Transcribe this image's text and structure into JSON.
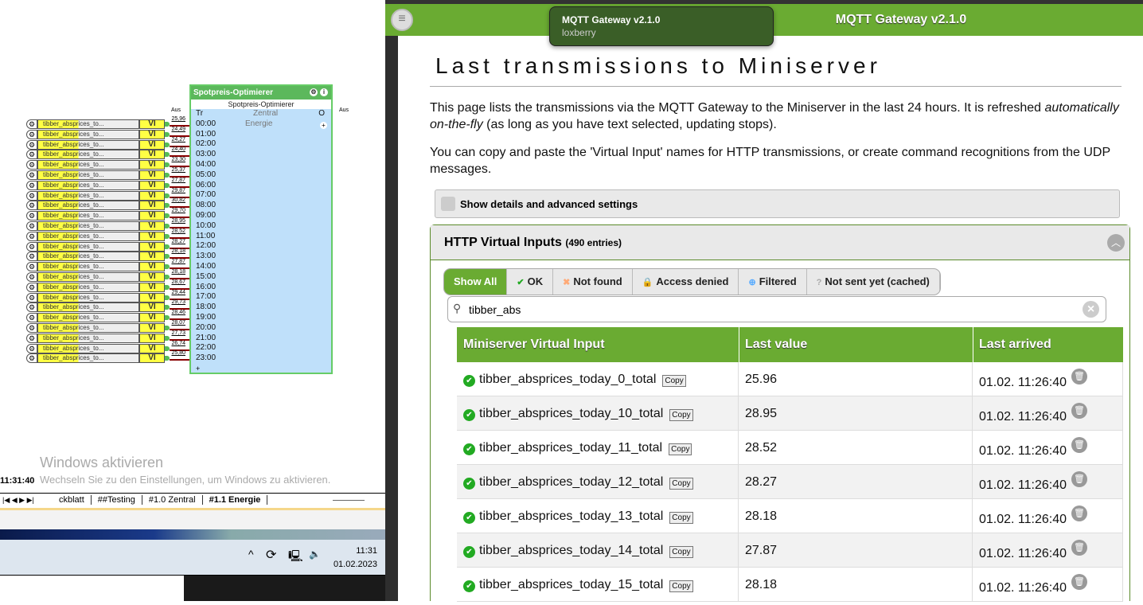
{
  "loxone": {
    "vi_name": "tibber_absprices_to...",
    "vi_label": "VI",
    "vi_values": [
      "25,96",
      "24,49",
      "24,27",
      "24,40",
      "23,30",
      "25,37",
      "27,87",
      "29,87",
      "30,82",
      "29,70",
      "28,95",
      "28,52",
      "28,27",
      "28,18",
      "27,87",
      "28,18",
      "28,67",
      "29,44",
      "29,73",
      "28,46",
      "28,07",
      "27,73",
      "26,74",
      "25,80"
    ],
    "wire_label": "---",
    "aus_in": "Aus",
    "aus_out": "Aus",
    "block_title": "Spotpreis-Optimierer",
    "block_subtitle": "Spotpreis-Optimierer",
    "input_tr": "Tr",
    "room": "Zentral",
    "category": "Energie",
    "output_o": "O",
    "hours": [
      "00:00",
      "01:00",
      "02:00",
      "03:00",
      "04:00",
      "05:00",
      "06:00",
      "07:00",
      "08:00",
      "09:00",
      "10:00",
      "11:00",
      "12:00",
      "13:00",
      "14:00",
      "15:00",
      "16:00",
      "17:00",
      "18:00",
      "19:00",
      "20:00",
      "21:00",
      "22:00",
      "23:00"
    ],
    "time": "11:31:40",
    "tabs": [
      "ckblatt",
      "##Testing",
      "#1.0 Zentral",
      "#1.1 Energie"
    ]
  },
  "windows": {
    "activate_title": "Windows aktivieren",
    "activate_text": "Wechseln Sie zu den Einstellungen, um Windows zu aktivieren.",
    "clock_time": "11:31",
    "clock_date": "01.02.2023"
  },
  "tooltip": {
    "title": "MQTT Gateway v2.1.0",
    "subtitle": "loxberry"
  },
  "header": {
    "title": "MQTT Gateway v2.1.0"
  },
  "page": {
    "title": "Last transmissions to Miniserver",
    "intro_1": "This page lists the transmissions via the MQTT Gateway to the Miniserver in the last 24 hours. It is refreshed ",
    "intro_em": "automatically on-the-fly",
    "intro_2": " (as long as you have text selected, updating stops).",
    "intro_p2": "You can copy and paste the 'Virtual Input' names for HTTP transmissions, or create command recognitions from the UDP messages.",
    "details_label": "Show details and advanced settings",
    "section_title": "HTTP Virtual Inputs",
    "section_count": "(490 entries)",
    "filters": [
      "Show All",
      "OK",
      "Not found",
      "Access denied",
      "Filtered",
      "Not sent yet (cached)"
    ],
    "search_value": "tibber_abs",
    "columns": [
      "Miniserver Virtual Input",
      "Last value",
      "Last arrived"
    ],
    "copy_label": "Copy",
    "rows": [
      {
        "name": "tibber_absprices_today_0_total",
        "value": "25.96",
        "arrived": "01.02. 11:26:40"
      },
      {
        "name": "tibber_absprices_today_10_total",
        "value": "28.95",
        "arrived": "01.02. 11:26:40"
      },
      {
        "name": "tibber_absprices_today_11_total",
        "value": "28.52",
        "arrived": "01.02. 11:26:40"
      },
      {
        "name": "tibber_absprices_today_12_total",
        "value": "28.27",
        "arrived": "01.02. 11:26:40"
      },
      {
        "name": "tibber_absprices_today_13_total",
        "value": "28.18",
        "arrived": "01.02. 11:26:40"
      },
      {
        "name": "tibber_absprices_today_14_total",
        "value": "27.87",
        "arrived": "01.02. 11:26:40"
      },
      {
        "name": "tibber_absprices_today_15_total",
        "value": "28.18",
        "arrived": "01.02. 11:26:40"
      }
    ]
  }
}
